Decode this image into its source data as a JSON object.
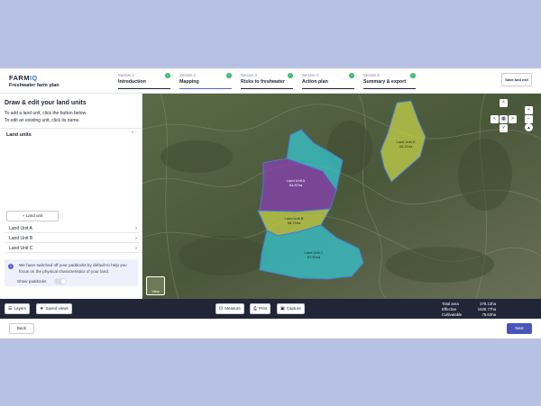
{
  "header": {
    "logo_main": "FARM",
    "logo_accent": "IQ",
    "plan_title": "Freshwater farm plan",
    "save_label": "Save and exit",
    "steps": [
      {
        "num": "Section 1",
        "name": "Introduction",
        "complete": true
      },
      {
        "num": "Section 2",
        "name": "Mapping",
        "complete": true
      },
      {
        "num": "Section 3",
        "name": "Risks to freshwater",
        "complete": true
      },
      {
        "num": "Section 4",
        "name": "Action plan",
        "complete": true
      },
      {
        "num": "Section 5",
        "name": "Summary & export",
        "complete": true
      }
    ],
    "check_glyph": "✓"
  },
  "panel": {
    "title": "Draw & edit your land units",
    "instruction_1": "To add a land unit, click the button below.",
    "instruction_2": "To edit an existing unit, click its name.",
    "section_label": "Land units",
    "add_label": "Land unit",
    "units": [
      "Land Unit A",
      "Land Unit B",
      "Land Unit C"
    ],
    "info_text": "We have switched off your paddocks by default to help you focus on the physical characteristics of your land.",
    "toggle_label": "Show paddocks",
    "toggle_on": false
  },
  "map": {
    "view_label": "View",
    "polygon_colors": {
      "unit_a": "#8a3fb8",
      "unit_b": "#c9d64a",
      "unit_c": "#35c9d4",
      "unit_d": "#c9d64a"
    },
    "labels": [
      {
        "id": "a",
        "text": "Land Unit A\n84.87ha"
      },
      {
        "id": "b",
        "text": "Land Unit B\n58.74ha"
      },
      {
        "id": "c",
        "text": "Land Unit C\n97.80ha"
      },
      {
        "id": "d",
        "text": "Land Unit D\n44.21ha"
      }
    ]
  },
  "toolbar": {
    "layers_label": "Layers",
    "saved_views_label": "Saved views",
    "measure_label": "Measure",
    "print_label": "Print",
    "capture_label": "Capture",
    "stats": [
      {
        "label": "Total area",
        "value": "278.13ha"
      },
      {
        "label": "Effective",
        "value": "1628.77ha"
      },
      {
        "label": "Cultivatable",
        "value": "76.62ha"
      }
    ]
  },
  "footer": {
    "back_label": "Back",
    "next_label": "Next"
  }
}
